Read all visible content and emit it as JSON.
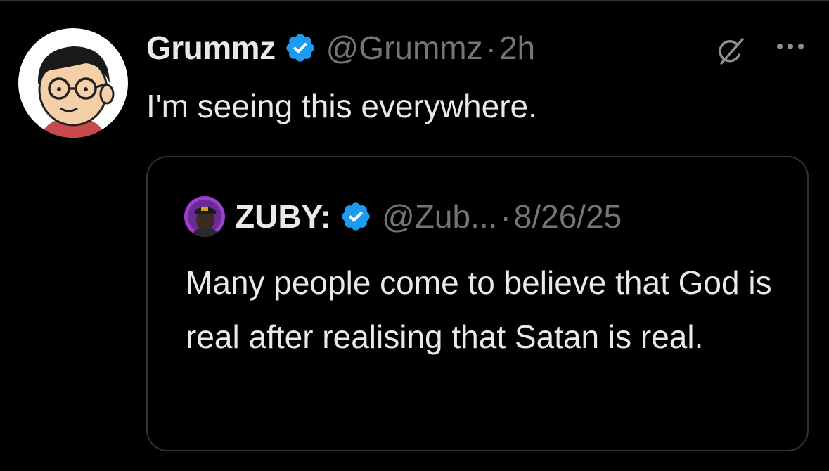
{
  "tweet": {
    "author_name": "Grummz",
    "author_handle": "@Grummz",
    "separator": "·",
    "time": "2h",
    "text": "I'm seeing this everywhere."
  },
  "quoted_tweet": {
    "author_name": "ZUBY:",
    "author_handle": "@Zub...",
    "separator": "·",
    "date": "8/26/25",
    "text": "Many people come to believe that God is real after realising that Satan is real."
  },
  "icons": {
    "verified": "verified-badge-icon",
    "grok": "grok-icon",
    "more": "more-options-icon"
  },
  "colors": {
    "background": "#000000",
    "primary_text": "#e7e9ea",
    "secondary_text": "#71767b",
    "verified_blue": "#1d9bf0",
    "border": "#2f3336"
  }
}
